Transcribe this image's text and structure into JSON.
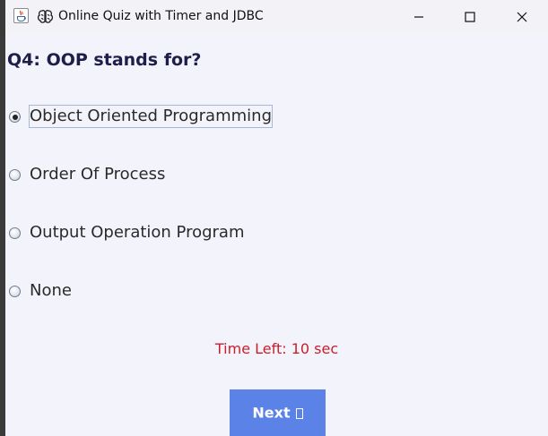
{
  "window": {
    "title": "Online Quiz with Timer and JDBC",
    "icons": [
      "java-app-icon",
      "brain-icon"
    ],
    "controls": [
      "minimize-icon",
      "maximize-icon",
      "close-icon"
    ]
  },
  "quiz": {
    "question": "Q4: OOP stands for?",
    "options": [
      {
        "label": "Object Oriented Programming",
        "selected": true
      },
      {
        "label": "Order Of Process",
        "selected": false
      },
      {
        "label": "Output Operation Program",
        "selected": false
      },
      {
        "label": "None",
        "selected": false
      }
    ],
    "timer_text": "Time Left: 10 sec",
    "next_label": "Next"
  },
  "colors": {
    "question_text": "#1e1e4a",
    "timer_text": "#c8202a",
    "next_button_bg": "#5b82e6",
    "content_bg": "#f3f3fb"
  }
}
